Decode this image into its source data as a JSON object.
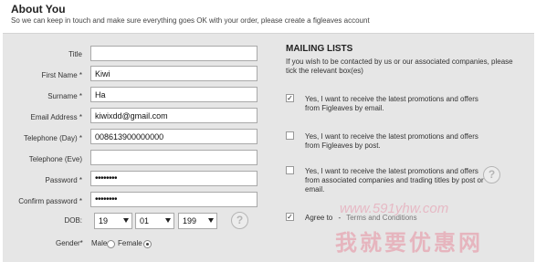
{
  "section": {
    "heading": "About You",
    "intro": "So we can keep in touch and make sure everything goes OK with your order, please create a figleaves account"
  },
  "form": {
    "title_label": "Title",
    "title_value": "",
    "first_name_label": "First Name *",
    "first_name_value": "Kiwi",
    "surname_label": "Surname *",
    "surname_value": "Ha",
    "email_label": "Email Address *",
    "email_value": "kiwixdd@gmail.com",
    "tel_day_label": "Telephone (Day) *",
    "tel_day_value": "008613900000000",
    "tel_eve_label": "Telephone (Eve)",
    "tel_eve_value": "",
    "password_label": "Password *",
    "password_value": "••••••••",
    "confirm_label": "Confirm password *",
    "confirm_value": "••••••••",
    "dob_label": "DOB:",
    "dob_day": "19",
    "dob_month": "01",
    "dob_year": "199",
    "gender_label": "Gender*",
    "gender_male": "Male",
    "gender_female": "Female",
    "gender_selected": "Female"
  },
  "mailing": {
    "title": "MAILING LISTS",
    "description": "If you wish to be contacted by us or our associated companies, please tick the relevant box(es)",
    "options": [
      {
        "label": "Yes, I want to receive the latest promotions and offers from Figleaves by email.",
        "checked": true
      },
      {
        "label": "Yes, I want to receive the latest promotions and offers from Figleaves by post.",
        "checked": false
      },
      {
        "label": "Yes, I want to receive the latest promotions and offers from associated companies and trading titles by post or email.",
        "checked": false
      }
    ],
    "agree_label": "Agree to",
    "agree_sep": "-",
    "terms_link": "Terms and Conditions",
    "agree_checked": true
  },
  "help_icon_glyph": "?",
  "watermark": {
    "url": "www.591yhw.com",
    "text": "我就要优惠网"
  }
}
